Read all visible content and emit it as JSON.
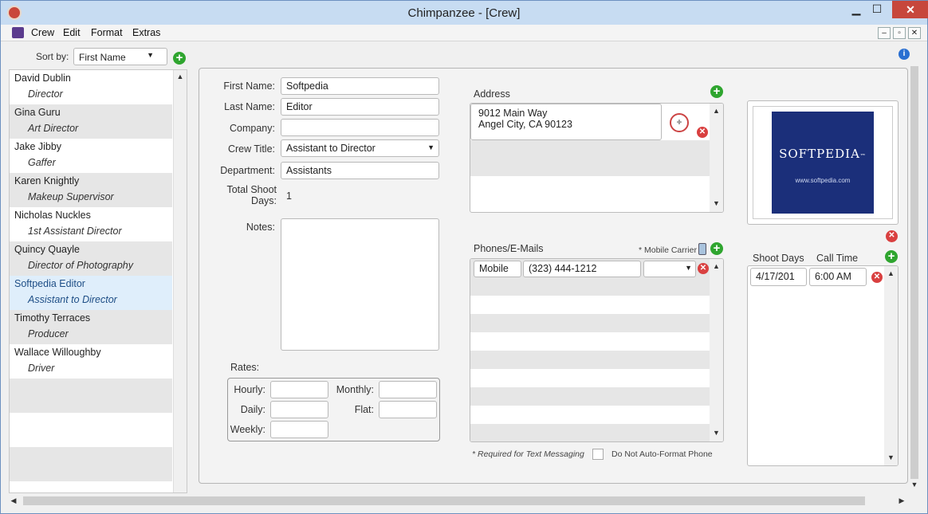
{
  "window": {
    "title": "Chimpanzee - [Crew]",
    "minimize": "▁",
    "maximize": "☐",
    "close": "✕"
  },
  "menu": [
    "Crew",
    "Edit",
    "Format",
    "Extras"
  ],
  "mdi": {
    "minimize": "–",
    "restore": "▫",
    "close": "✕"
  },
  "sort": {
    "label": "Sort by:",
    "value": "First Name"
  },
  "crew": [
    {
      "name": "David Dublin",
      "role": "Director"
    },
    {
      "name": "Gina Guru",
      "role": "Art Director"
    },
    {
      "name": "Jake Jibby",
      "role": "Gaffer"
    },
    {
      "name": "Karen Knightly",
      "role": "Makeup Supervisor"
    },
    {
      "name": "Nicholas Nuckles",
      "role": "1st Assistant Director"
    },
    {
      "name": "Quincy Quayle",
      "role": "Director of Photography"
    },
    {
      "name": "Softpedia Editor",
      "role": "Assistant to Director"
    },
    {
      "name": "Timothy Terraces",
      "role": "Producer"
    },
    {
      "name": "Wallace Willoughby",
      "role": "Driver"
    }
  ],
  "form": {
    "first_name_label": "First Name:",
    "first_name": "Softpedia",
    "last_name_label": "Last Name:",
    "last_name": "Editor",
    "company_label": "Company:",
    "company": "",
    "crew_title_label": "Crew Title:",
    "crew_title": "Assistant to Director",
    "department_label": "Department:",
    "department": "Assistants",
    "total_shoot_label_1": "Total Shoot",
    "total_shoot_label_2": "Days:",
    "total_shoot_days": "1",
    "notes_label": "Notes:",
    "notes": "",
    "rates_label": "Rates:",
    "hourly_label": "Hourly:",
    "monthly_label": "Monthly:",
    "daily_label": "Daily:",
    "flat_label": "Flat:",
    "weekly_label": "Weekly:"
  },
  "address": {
    "label": "Address",
    "line1": "9012 Main Way",
    "line2": "Angel City, CA 90123"
  },
  "phones": {
    "label": "Phones/E-Mails",
    "mobile_carrier": "* Mobile Carrier",
    "type": "Mobile",
    "number": "(323) 444-1212",
    "carrier": ""
  },
  "footer": {
    "required_hint": "* Required for Text Messaging",
    "no_format": "Do Not Auto-Format Phone"
  },
  "photo": {
    "brand": "SOFTPEDIA",
    "tm": "™",
    "url": "www.softpedia.com"
  },
  "shoot": {
    "days_label": "Shoot Days",
    "call_label": "Call Time",
    "date": "4/17/201",
    "time": "6:00 AM"
  },
  "colors": {
    "selected_row": "#dfeefb",
    "stripe": "#e6e6e6",
    "add_green": "#2fa52f",
    "delete_red": "#d94040"
  }
}
